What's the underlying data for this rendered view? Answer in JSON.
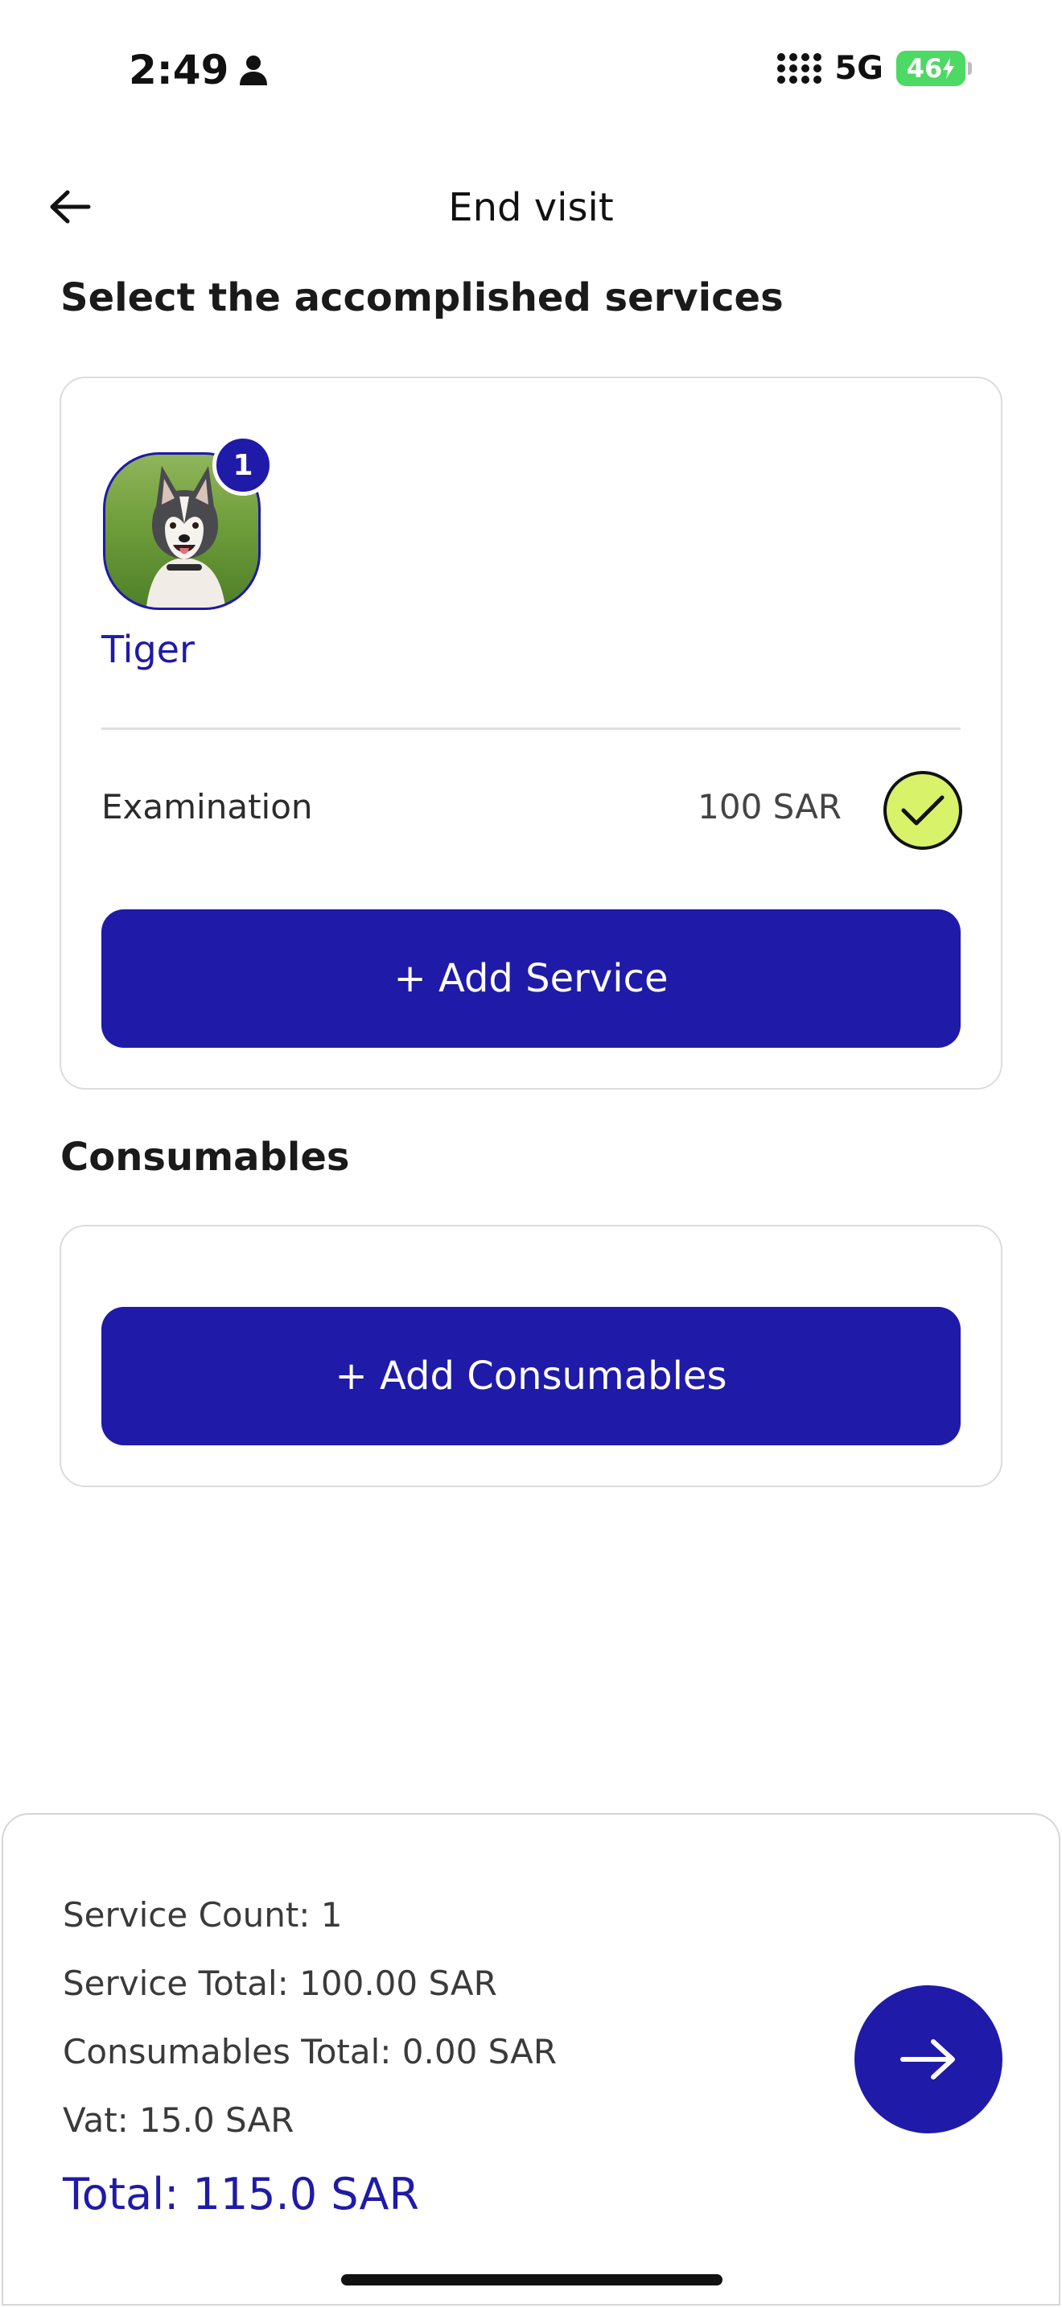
{
  "status_bar": {
    "time": "2:49",
    "network": "5G",
    "battery": "46"
  },
  "header": {
    "title": "End visit",
    "back_icon": "arrow-left-icon"
  },
  "services_section": {
    "heading": "Select the accomplished services",
    "pet": {
      "name": "Tiger",
      "badge": "1"
    },
    "services": [
      {
        "name": "Examination",
        "price": "100 SAR",
        "checked": true
      }
    ],
    "add_button": "+ Add Service"
  },
  "consumables_section": {
    "heading": "Consumables",
    "add_button": "+ Add Consumables"
  },
  "summary": {
    "service_count": "Service Count: 1",
    "service_total": "Service Total: 100.00 SAR",
    "consumables_total": "Consumables Total: 0.00 SAR",
    "vat": "Vat: 15.0 SAR",
    "total": "Total: 115.0 SAR",
    "next_icon": "arrow-right-icon"
  },
  "colors": {
    "primary": "#1f1aa8",
    "check_fill": "#d8f26a",
    "battery": "#4cd964"
  }
}
